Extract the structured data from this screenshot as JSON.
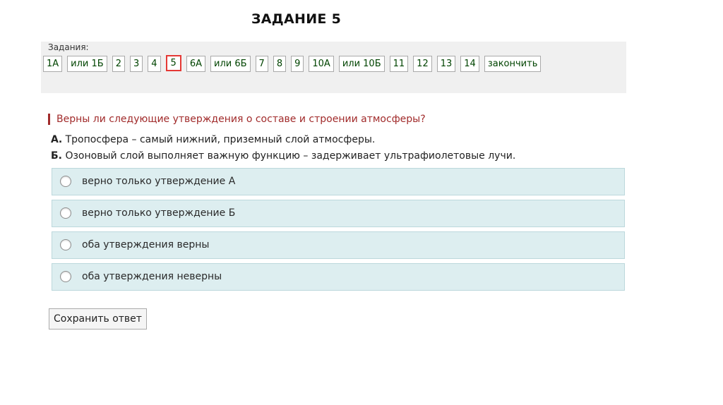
{
  "slide_title": "ЗАДАНИЕ 5",
  "tasks": {
    "label": "Задания:",
    "items": [
      {
        "label": "1А",
        "current": false
      },
      {
        "label": "или 1Б",
        "current": false
      },
      {
        "label": "2",
        "current": false
      },
      {
        "label": "3",
        "current": false
      },
      {
        "label": "4",
        "current": false
      },
      {
        "label": "5",
        "current": true
      },
      {
        "label": "6А",
        "current": false
      },
      {
        "label": "или 6Б",
        "current": false
      },
      {
        "label": "7",
        "current": false
      },
      {
        "label": "8",
        "current": false
      },
      {
        "label": "9",
        "current": false
      },
      {
        "label": "10А",
        "current": false
      },
      {
        "label": "или 10Б",
        "current": false
      },
      {
        "label": "11",
        "current": false
      },
      {
        "label": "12",
        "current": false
      },
      {
        "label": "13",
        "current": false
      },
      {
        "label": "14",
        "current": false
      },
      {
        "label": "закончить",
        "current": false
      }
    ]
  },
  "question": {
    "text": "Верны ли следующие утверждения о составе и строении атмосферы?",
    "statement_a": {
      "prefix": "А.",
      "text": " Тропосфера – самый нижний, приземный слой атмосферы."
    },
    "statement_b": {
      "prefix": "Б.",
      "text": " Озоновый слой выполняет важную функцию – задерживает ультрафиолетовые лучи."
    },
    "options": [
      {
        "label": "верно только утверждение А",
        "selected": false
      },
      {
        "label": "верно только утверждение Б",
        "selected": false
      },
      {
        "label": "оба утверждения верны",
        "selected": false
      },
      {
        "label": "оба утверждения неверны",
        "selected": false
      }
    ]
  },
  "save_button": "Сохранить ответ",
  "colors": {
    "question_accent": "#a12b2b",
    "current_task_border": "#e53935",
    "task_text": "#004400",
    "option_background": "#ddeef0",
    "panel_background": "#f0f0f0"
  }
}
